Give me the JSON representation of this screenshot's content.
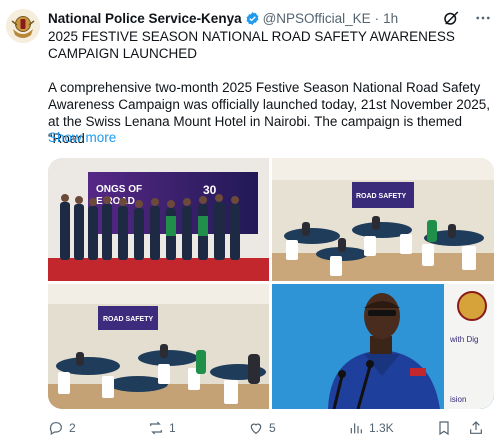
{
  "post": {
    "author_name": "National Police Service-Kenya",
    "handle": "@NPSOfficial_KE",
    "separator": "·",
    "time": "1h",
    "title": "2025 FESTIVE SEASON NATIONAL ROAD SAFETY AWARENESS CAMPAIGN LAUNCHED",
    "body": "A comprehensive two-month 2025 Festive Season National Road Safety Awareness Campaign was officially launched today, 21st November 2025, at the Swiss Lenana Mount Hotel in Nairobi. The campaign is themed “Road",
    "show_more": "Show more"
  },
  "photos": {
    "photo1": {
      "banner_l1": "ONGS OF",
      "banner_l2": "E ROAD",
      "banner_num": "30"
    },
    "photo2": {
      "banner": "ROAD SAFETY"
    },
    "photo3": {
      "banner": "ROAD SAFETY"
    },
    "photo4": {
      "side_text": "ision",
      "side_text2": "with Dig"
    }
  },
  "actions": {
    "replies": "2",
    "reposts": "1",
    "likes": "5",
    "views": "1.3K"
  },
  "colors": {
    "accent": "#1d9bf0",
    "verified": "#1d9bf0",
    "uniform": "#1f3f9c"
  },
  "icons": [
    "verified-badge-icon",
    "grok-icon",
    "more-icon",
    "reply-icon",
    "repost-icon",
    "like-icon",
    "views-icon",
    "bookmark-icon",
    "share-icon"
  ]
}
